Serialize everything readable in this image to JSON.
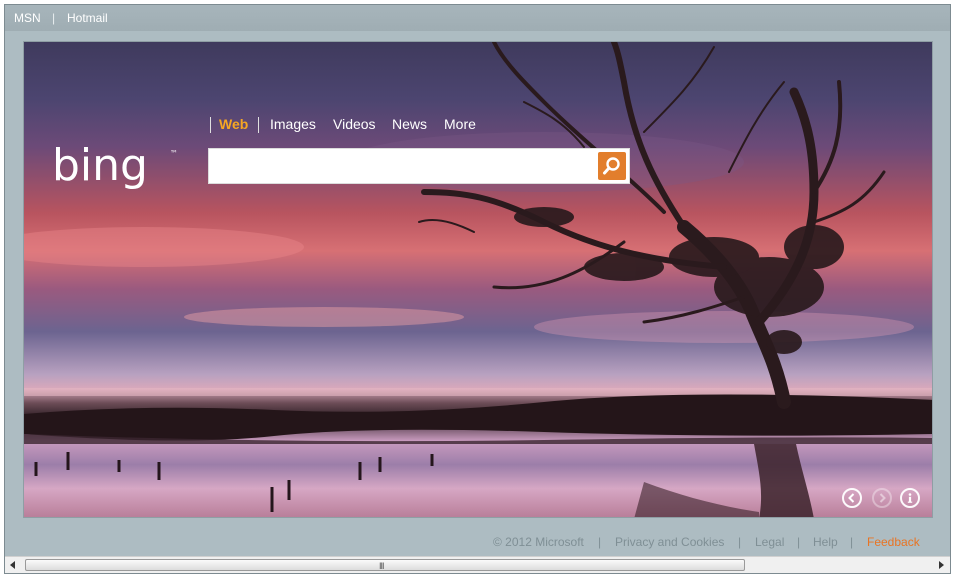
{
  "topnav": {
    "msn": "MSN",
    "separator": "|",
    "hotmail": "Hotmail"
  },
  "search": {
    "tabs": {
      "web": "Web",
      "images": "Images",
      "videos": "Videos",
      "news": "News",
      "more": "More"
    },
    "active_tab": "Web",
    "query_value": "",
    "placeholder": "",
    "button_icon": "magnifier-icon",
    "accent_color": "#e27e2c",
    "active_tab_color": "#f5a623"
  },
  "logo": {
    "text": "bing",
    "trademark": "™"
  },
  "hero_controls": {
    "previous_icon": "chevron-left-icon",
    "next_icon": "chevron-right-icon",
    "info_icon": "info-icon",
    "next_enabled": false
  },
  "footer": {
    "copyright": "© 2012 Microsoft",
    "separator": "|",
    "privacy": "Privacy and Cookies",
    "legal": "Legal",
    "help": "Help",
    "feedback": "Feedback",
    "feedback_color": "#e87424"
  },
  "scrollbar": {
    "grip": "III",
    "left_icon": "arrow-left-icon",
    "right_icon": "arrow-right-icon"
  }
}
